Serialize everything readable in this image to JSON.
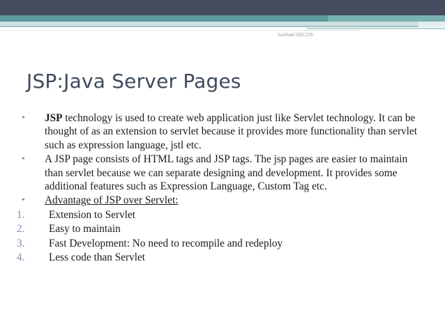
{
  "slide": {
    "footer": "SarthakCSEC226",
    "title": "JSP:Java Server Pages",
    "bullets": [
      {
        "marker": "•",
        "lead": "JSP",
        "text": " technology is used to create web application just like Servlet technology. It can be thought of as an extension to servlet because it provides more functionality than servlet such as expression language, jstl etc."
      },
      {
        "marker": "•",
        "text": "A JSP page consists of HTML tags and JSP tags. The jsp pages are easier to maintain than servlet because we can separate designing and development. It provides some additional features such as Expression Language, Custom Tag etc."
      },
      {
        "marker": "•",
        "text": "Advantage of JSP over Servlet:"
      }
    ],
    "numbered": [
      {
        "marker": "1.",
        "text": "Extension to Servlet"
      },
      {
        "marker": "2.",
        "text": "Easy to maintain"
      },
      {
        "marker": "3.",
        "text": "Fast Development: No need to recompile and redeploy"
      },
      {
        "marker": "4.",
        "text": "Less code than Servlet"
      }
    ]
  },
  "colors": {
    "header_dark": "#454c5f",
    "header_teal": "#5a9a9b",
    "title_text": "#3f4a5c",
    "marker": "#7f8fa8",
    "body_text": "#1a1a1a"
  }
}
